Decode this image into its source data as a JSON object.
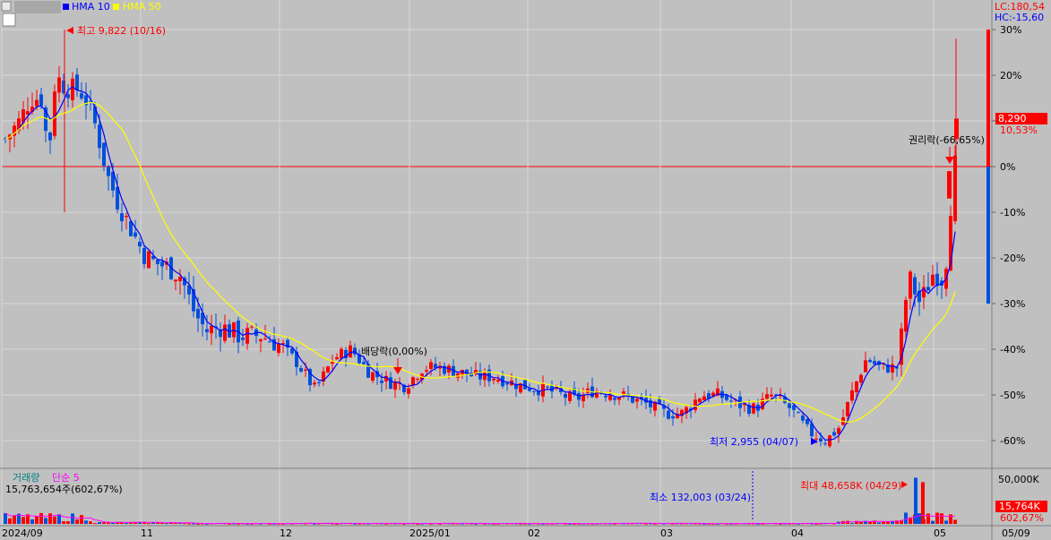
{
  "legend": {
    "ma_short": "HMA 10",
    "ma_long": "HMA 50",
    "color_short": "#0000ff",
    "color_long": "#ffff00"
  },
  "header_right": {
    "lc": "LC:180,54",
    "hc": "HC:-15,60"
  },
  "price": {
    "current": "8,290",
    "change_pct": "10,53%"
  },
  "annotations": {
    "high": "최고 9,822 (10/16)",
    "low": "최저 2,955 (04/07)",
    "dividend": "배당락(0,00%)",
    "rights": "권리락(-66,65%)"
  },
  "volume_panel": {
    "title": "거래량",
    "ma_label": "단순 5",
    "current": "15,763,654주(602,67%)",
    "max": "최대 48,658K (04/29)",
    "min": "최소 132,003 (03/24)",
    "scale_top": "50,000K",
    "current_badge": "15,764K",
    "current_pct": "602,67%"
  },
  "colors": {
    "up": "#ff0000",
    "down": "#0050dc",
    "background": "#c0c0c0",
    "grid": "#d8d8d8",
    "zero_line": "#ff0000",
    "volume_ma": "#ff00ff"
  },
  "chart_data": {
    "type": "candlestick",
    "y_unit": "%",
    "ylim": [
      -62,
      30
    ],
    "y_ticks": [
      "30%",
      "20%",
      "10%",
      "0%",
      "-10%",
      "-20%",
      "-30%",
      "-40%",
      "-50%",
      "-60%"
    ],
    "x_labels": [
      "2024/09",
      "11",
      "12",
      "2025/01",
      "02",
      "03",
      "04",
      "05",
      "05/09"
    ],
    "volume_ylim": [
      0,
      50000
    ]
  }
}
